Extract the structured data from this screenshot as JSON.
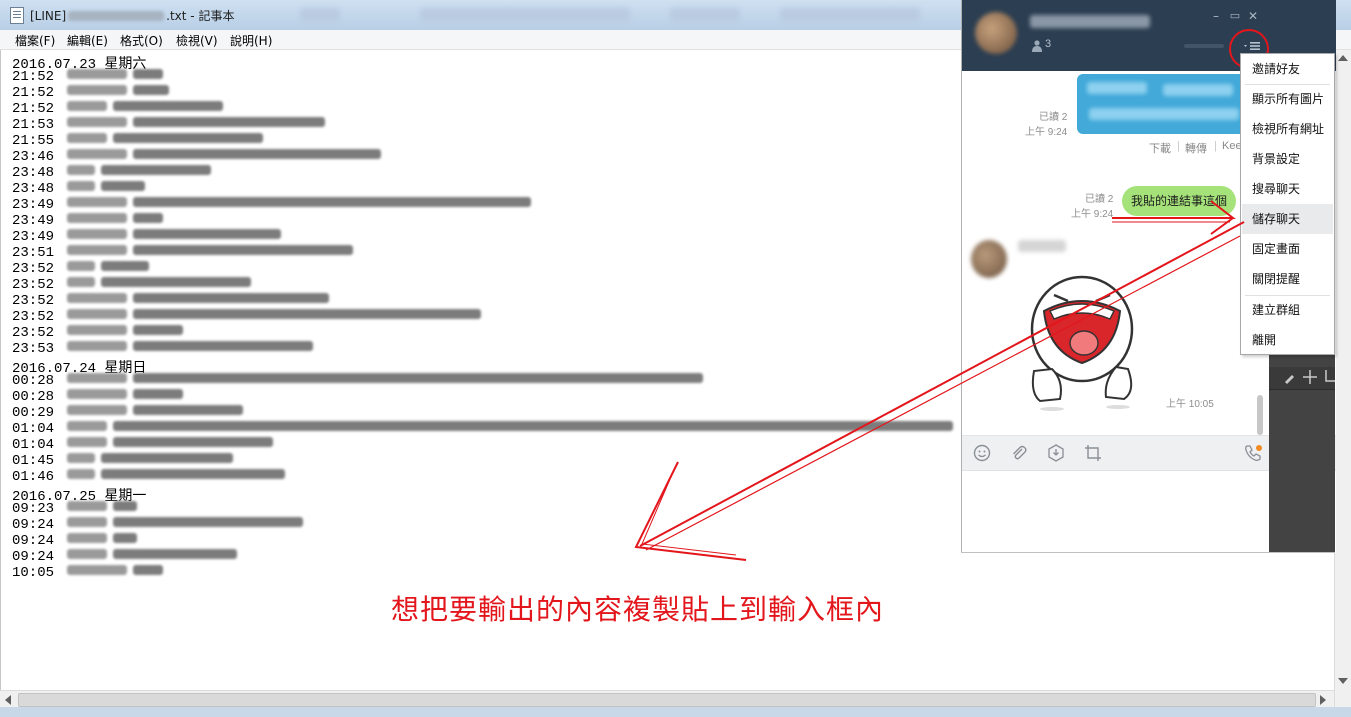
{
  "notepad": {
    "title_prefix": "[LINE]",
    "title_suffix": ".txt - 記事本",
    "menus": [
      "檔案(F)",
      "編輯(E)",
      "格式(O)",
      "檢視(V)",
      "說明(H)"
    ]
  },
  "log": {
    "dates": [
      "2016.07.23 星期六",
      "2016.07.24 星期日",
      "2016.07.25 星期一"
    ],
    "day1_times": [
      "21:52",
      "21:52",
      "21:52",
      "21:53",
      "21:55",
      "23:46",
      "23:48",
      "23:48",
      "23:49",
      "23:49",
      "23:49",
      "23:51",
      "23:52",
      "23:52",
      "23:52",
      "23:52",
      "23:52",
      "23:53"
    ],
    "day2_times": [
      "00:28",
      "00:28",
      "00:29",
      "01:04",
      "01:04",
      "01:45",
      "01:46"
    ],
    "day3_times": [
      "09:23",
      "09:24",
      "09:24",
      "09:24",
      "10:05"
    ]
  },
  "line_chat": {
    "member_count": "3",
    "read_receipt_1": "已讀 2",
    "time_1": "上午 9:24",
    "image_actions": [
      "下載",
      "轉傳",
      "Kee"
    ],
    "read_receipt_2": "已讀 2",
    "time_2": "上午 9:24",
    "my_message": "我貼的連結事這個",
    "sticker_time": "上午 10:05",
    "menu_items": [
      "邀請好友",
      "顯示所有圖片",
      "檢視所有網址",
      "背景設定",
      "搜尋聊天",
      "儲存聊天",
      "固定畫面",
      "關閉提醒",
      "建立群組",
      "離開"
    ],
    "highlighted_menu_item": "儲存聊天"
  },
  "annotation": {
    "text": "想把要輸出的內容複製貼上到輸入框內",
    "color": "#e3161c"
  },
  "colors": {
    "line_header": "#2c3e52",
    "my_bubble": "#a6e27a",
    "image_bubble": "#42a9d9"
  }
}
